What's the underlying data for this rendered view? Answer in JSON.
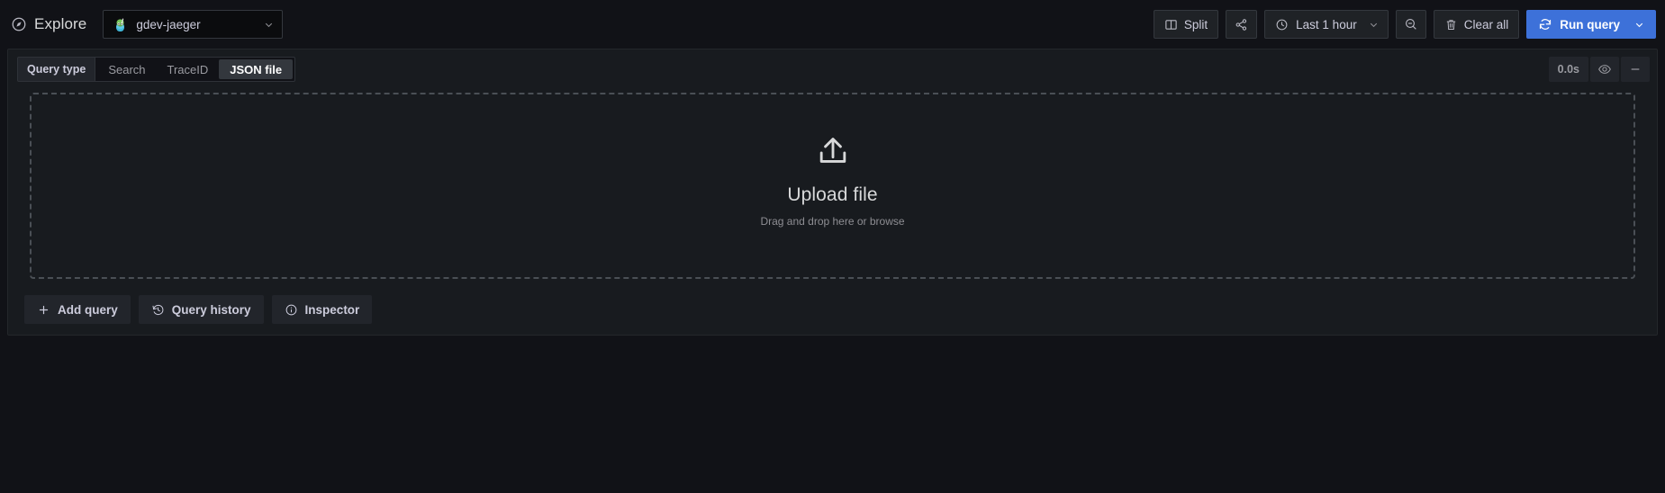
{
  "header": {
    "brand_icon": "compass-icon",
    "brand_label": "Explore",
    "datasource": {
      "icon": "jaeger-logo-icon",
      "name": "gdev-jaeger",
      "caret_icon": "chevron-down-icon"
    },
    "actions": {
      "split_icon": "split-panes-icon",
      "split_label": "Split",
      "share_icon": "share-nodes-icon",
      "time_icon": "clock-icon",
      "time_label": "Last 1 hour",
      "time_caret_icon": "chevron-down-icon",
      "zoom_out_icon": "search-minus-icon",
      "clear_icon": "trash-icon",
      "clear_label": "Clear all",
      "run_icon": "sync-refresh-icon",
      "run_label": "Run query",
      "run_caret_icon": "chevron-down-icon"
    }
  },
  "query_panel": {
    "query_type_label": "Query type",
    "query_type_options": [
      {
        "label": "Search",
        "active": false
      },
      {
        "label": "TraceID",
        "active": false
      },
      {
        "label": "JSON file",
        "active": true
      }
    ],
    "duration": "0.0s",
    "visibility_icon": "eye-icon",
    "collapse_icon": "minus-icon",
    "dropzone": {
      "icon": "upload-arrow-icon",
      "title": "Upload file",
      "subtitle": "Drag and drop here or browse"
    },
    "footer_buttons": [
      {
        "icon": "plus-icon",
        "label": "Add query"
      },
      {
        "icon": "history-clock-icon",
        "label": "Query history"
      },
      {
        "icon": "info-circle-icon",
        "label": "Inspector"
      }
    ]
  },
  "colors": {
    "page_background": "#111217",
    "panel_background": "#181b1f",
    "primary_button": "#3d71d9",
    "text_primary": "#ccccdc",
    "text_secondary": "#9a9ba1",
    "dashed_border": "#4a4f55"
  }
}
